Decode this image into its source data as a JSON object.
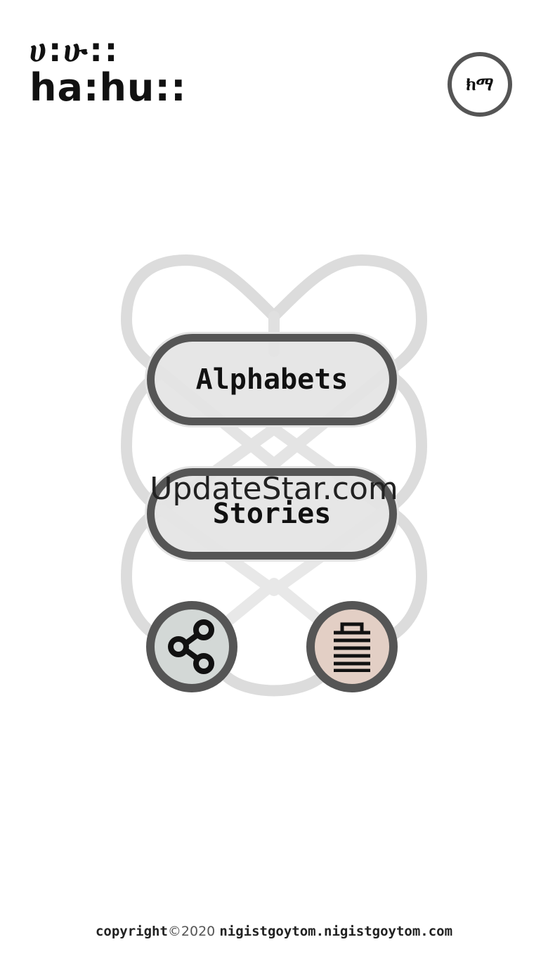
{
  "logo": {
    "geez_text": "ሀ:ሁ::",
    "latin_text": "ha:hu::"
  },
  "language_button": {
    "label": "ክማ"
  },
  "menu": {
    "alphabets_label": "Alphabets",
    "stories_label": "Stories"
  },
  "watermark": {
    "text": "UpdateStar.com"
  },
  "icons": {
    "share": "share-icon",
    "menu": "stacked-lines-icon",
    "background": "interlaced-knot-pattern"
  },
  "footer": {
    "copyright_word": "copyright",
    "year": "©2020",
    "site": "nigistgoytom.nigistgoytom.com"
  },
  "colors": {
    "border": "#555555",
    "button_fill": "#e4e4e4",
    "share_fill": "#d3d8d6",
    "menu_fill": "#e3cfc5",
    "knot": "#dcdcdc"
  }
}
